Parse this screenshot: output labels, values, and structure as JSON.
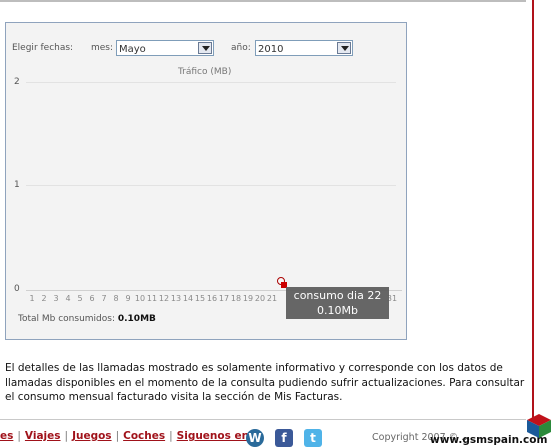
{
  "filters": {
    "choose_dates": "Elegir fechas:",
    "month_label": "mes:",
    "month_value": "Mayo",
    "year_label": "año:",
    "year_value": "2010"
  },
  "chart_data": {
    "type": "line",
    "title": "Tráfico (MB)",
    "xlabel": "",
    "ylabel": "",
    "ylim": [
      0,
      2
    ],
    "yticks": [
      "0",
      "1",
      "2"
    ],
    "x": [
      "1",
      "2",
      "3",
      "4",
      "5",
      "6",
      "7",
      "8",
      "9",
      "10",
      "11",
      "12",
      "13",
      "14",
      "15",
      "16",
      "17",
      "18",
      "19",
      "20",
      "21",
      "31"
    ],
    "series": [
      {
        "points": [
          {
            "x": 22,
            "y": 0.1
          }
        ]
      }
    ],
    "tooltip": {
      "line1": "consumo dia 22",
      "line2": "0.10Mb"
    },
    "grid": true
  },
  "total": {
    "label": "Total Mb consumidos:",
    "value": "0.10MB"
  },
  "note": "El detalles de las llamadas mostrado es solamente informativo y corresponde con los datos de llamadas disponibles en el momento de la consulta pudiendo sufrir actualizaciones. Para consultar el consumo mensual facturado visita la sección de Mis Facturas.",
  "footer": {
    "links": [
      "es",
      "Viajes",
      "Juegos",
      "Coches",
      "Siguenos en"
    ],
    "copyright": "Copyright 2007 © ...",
    "watermark": "www.gsmspain.com"
  },
  "colors": {
    "brand_red": "#a0121a",
    "panel_border": "#8fa3bd",
    "tooltip_bg": "#5f5f5f"
  },
  "icons": [
    "wordpress-icon",
    "facebook-icon",
    "twitter-icon",
    "cube-logo-icon"
  ]
}
